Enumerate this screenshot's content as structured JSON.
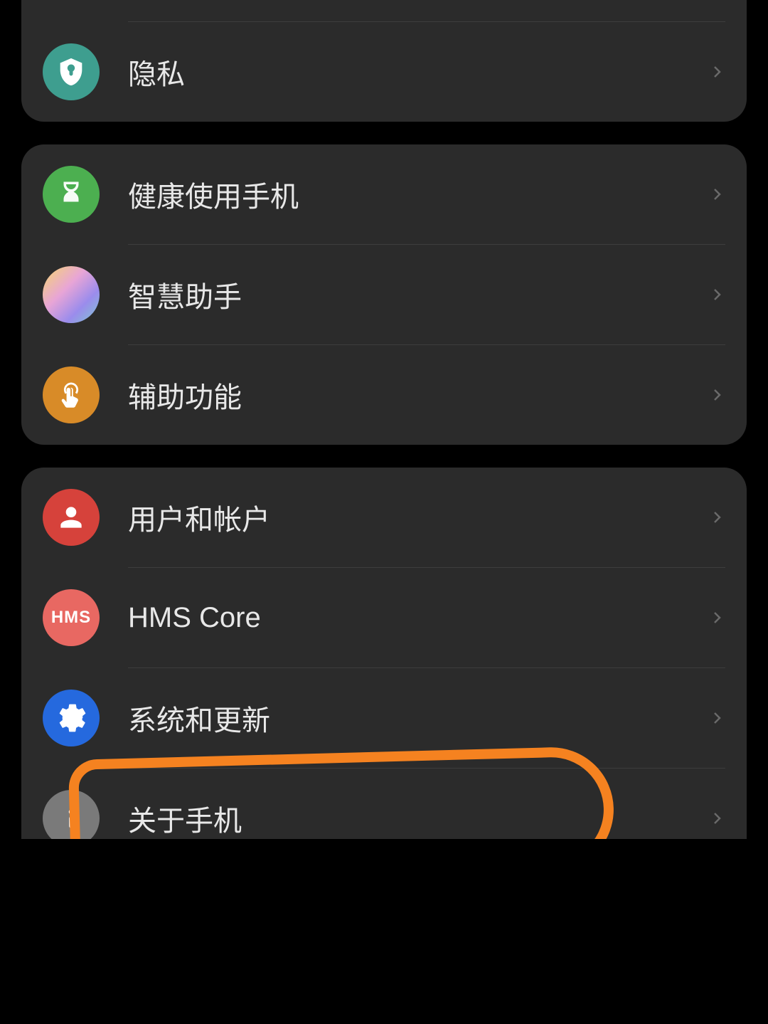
{
  "groups": [
    {
      "items": [
        {
          "id": "security",
          "label": "",
          "icon": "security-icon",
          "iconBg": "teal",
          "partial": true
        },
        {
          "id": "privacy",
          "label": "隐私",
          "icon": "privacy-shield-icon",
          "iconBg": "teal"
        }
      ]
    },
    {
      "items": [
        {
          "id": "digital-balance",
          "label": "健康使用手机",
          "icon": "hourglass-icon",
          "iconBg": "green"
        },
        {
          "id": "smart-assistant",
          "label": "智慧助手",
          "icon": "wave-icon",
          "iconBg": "gradient"
        },
        {
          "id": "accessibility",
          "label": "辅助功能",
          "icon": "touch-icon",
          "iconBg": "orange"
        }
      ]
    },
    {
      "items": [
        {
          "id": "users-accounts",
          "label": "用户和帐户",
          "icon": "person-icon",
          "iconBg": "red"
        },
        {
          "id": "hms-core",
          "label": "HMS Core",
          "icon": "hms-text-icon",
          "iconBg": "lightred"
        },
        {
          "id": "system-update",
          "label": "系统和更新",
          "icon": "gear-icon",
          "iconBg": "blue"
        },
        {
          "id": "about-phone",
          "label": "关于手机",
          "icon": "info-icon",
          "iconBg": "grey",
          "highlighted": true
        }
      ]
    }
  ],
  "hmsLabel": "HMS"
}
